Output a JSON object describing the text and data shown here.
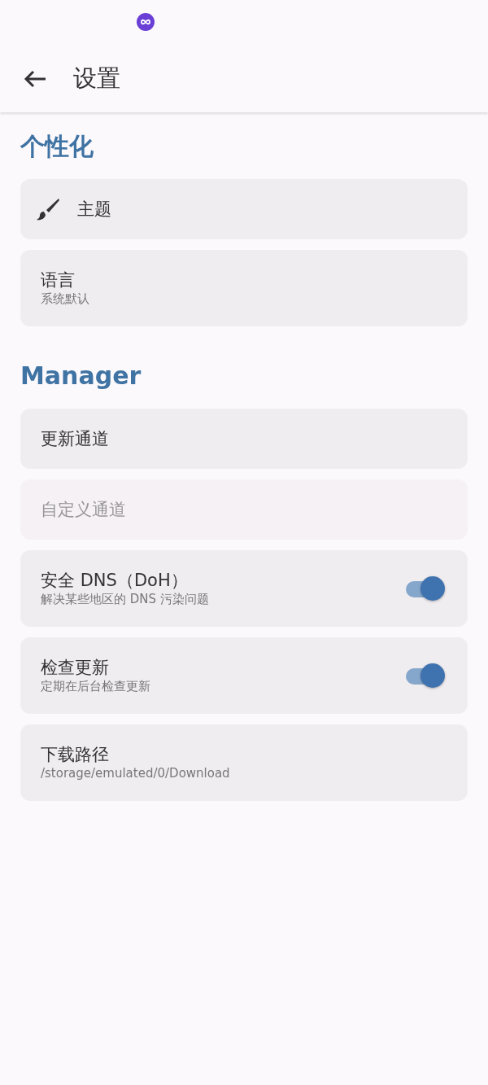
{
  "app_bar": {
    "title": "设置"
  },
  "sections": [
    {
      "title": "个性化",
      "items": [
        {
          "kind": "icon",
          "title": "主题",
          "disabled": false
        },
        {
          "kind": "text",
          "title": "语言",
          "subtitle": "系统默认",
          "disabled": false
        }
      ]
    },
    {
      "title": "Manager",
      "items": [
        {
          "kind": "text",
          "title": "更新通道",
          "disabled": false
        },
        {
          "kind": "text",
          "title": "自定义通道",
          "disabled": true
        },
        {
          "kind": "switch",
          "title": "安全 DNS（DoH）",
          "subtitle": "解决某些地区的 DNS 污染问题",
          "on": true,
          "disabled": false
        },
        {
          "kind": "switch",
          "title": "检查更新",
          "subtitle": "定期在后台检查更新",
          "on": true,
          "disabled": false
        },
        {
          "kind": "text",
          "title": "下载路径",
          "subtitle": "/storage/emulated/0/Download",
          "disabled": false
        }
      ]
    }
  ]
}
